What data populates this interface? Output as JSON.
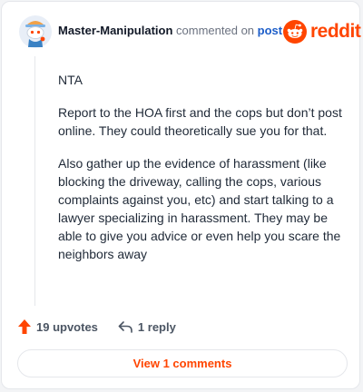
{
  "comment": {
    "username": "Master-Manipulation",
    "action_text": "commented on",
    "post_link": "post",
    "paragraphs": [
      "NTA",
      "Report to the HOA first and the cops but don’t post online. They could theoretically sue you for that.",
      "Also gather up the evidence of harassment (like blocking the driveway, calling the cops, various complaints against you, etc) and start talking to a lawyer specializing in harassment. They may be able to give you advice or even help you scare the neighbors away"
    ]
  },
  "brand": {
    "wordmark": "reddit",
    "logo_icon": "reddit-snoo-icon",
    "color": "#ff4500"
  },
  "avatar": {
    "icon": "snoo-avatar-icon"
  },
  "actions": {
    "upvote_label": "19 upvotes",
    "upvote_icon": "upvote-arrow-icon",
    "upvote_color": "#ff4500",
    "reply_label": "1 reply",
    "reply_icon": "reply-arrow-icon"
  },
  "view_comments": {
    "label": "View 1 comments"
  }
}
